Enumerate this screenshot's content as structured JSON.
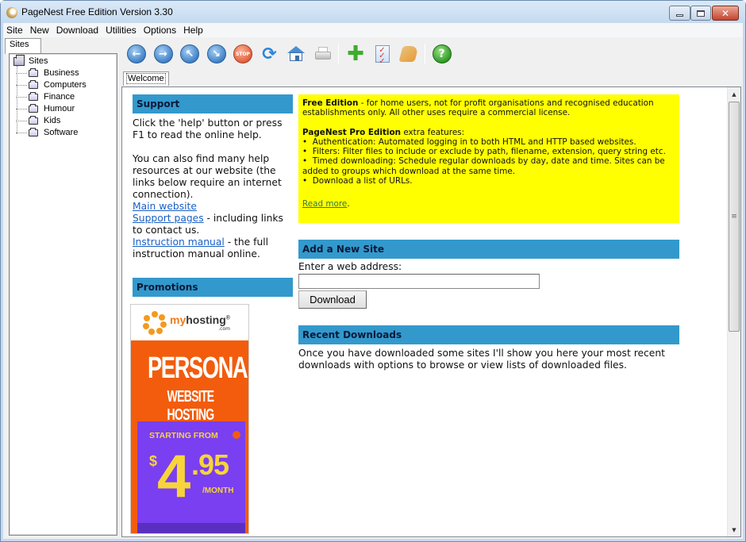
{
  "window": {
    "title": "PageNest Free Edition Version 3.30",
    "controls": {
      "minimize": "minimize",
      "maximize": "maximize",
      "close": "✕"
    }
  },
  "menubar": [
    "Site",
    "New",
    "Download",
    "Utilities",
    "Options",
    "Help"
  ],
  "left_panel": {
    "tab": "Sites",
    "tree": {
      "root": "Sites",
      "children": [
        "Business",
        "Computers",
        "Finance",
        "Humour",
        "Kids",
        "Software"
      ]
    }
  },
  "toolbar": {
    "buttons": [
      {
        "name": "back",
        "icon": "arrow-left-icon",
        "glyph": "←"
      },
      {
        "name": "forward",
        "icon": "arrow-right-icon",
        "glyph": "→"
      },
      {
        "name": "up",
        "icon": "arrow-up-left-icon",
        "glyph": "↖"
      },
      {
        "name": "download",
        "icon": "arrow-down-right-icon",
        "glyph": "↘"
      },
      {
        "name": "stop",
        "icon": "stop-icon",
        "glyph": "STOP"
      },
      {
        "name": "refresh",
        "icon": "refresh-icon",
        "glyph": "⟳"
      },
      {
        "name": "home",
        "icon": "home-icon"
      },
      {
        "name": "print",
        "icon": "printer-icon"
      },
      {
        "name": "add",
        "icon": "plus-icon",
        "glyph": "✚"
      },
      {
        "name": "checklist",
        "icon": "checklist-icon",
        "glyph": "✓✓✓"
      },
      {
        "name": "point",
        "icon": "hand-icon"
      },
      {
        "name": "help",
        "icon": "help-icon",
        "glyph": "?"
      }
    ]
  },
  "doc_tab": "Welcome",
  "support": {
    "header": "Support",
    "para1": "Click the 'help' button or press F1 to read the online help.",
    "para2": "You can also find many help resources at our website (the links below require an internet connection).",
    "links": [
      {
        "label": "Main website",
        "suffix": ""
      },
      {
        "label": "Support pages",
        "suffix": " - including links to contact us."
      },
      {
        "label": "Instruction manual",
        "suffix": " - the full instruction manual online."
      }
    ]
  },
  "promotions": {
    "header": "Promotions",
    "ad": {
      "brand_prefix": "my",
      "brand_suffix": "hosting",
      "brand_reg": "®",
      "brand_tld": ".com",
      "headline": "PERSONAL",
      "subheadline": "WEBSITE HOSTING",
      "starting": "STARTING FROM",
      "currency": "$",
      "price_whole": "4",
      "price_cents": ".95",
      "period": "/MONTH"
    }
  },
  "free_edition": {
    "title": "Free Edition",
    "desc": " - for home users, not for profit organisations and recognised education establishments only. All other uses require a commercial license.",
    "pro_title": "PageNest Pro Edition",
    "pro_suffix": " extra features:",
    "features": [
      "Authentication: Automated logging in to both HTML and HTTP based websites.",
      "Filters: Filter files to include or exclude by path, filename, extension, query string etc.",
      "Timed downloading: Schedule regular downloads by day, date and time. Sites can be added to groups which download at the same time.",
      "Download a list of URLs."
    ],
    "read_more": "Read more",
    "read_more_suffix": "."
  },
  "add_site": {
    "header": "Add a New Site",
    "label": "Enter a web address:",
    "input_value": "",
    "button": "Download"
  },
  "recent": {
    "header": "Recent Downloads",
    "text": "Once you have downloaded some sites I'll show you here your most recent downloads with options to browse or view lists of downloaded files."
  },
  "colors": {
    "section_header": "#3399cc",
    "highlight": "#ffff00",
    "link": "#1a5fc4",
    "ad_orange": "#f25c0c",
    "ad_purple": "#7a3ff0",
    "ad_yellow": "#f7d43a"
  }
}
